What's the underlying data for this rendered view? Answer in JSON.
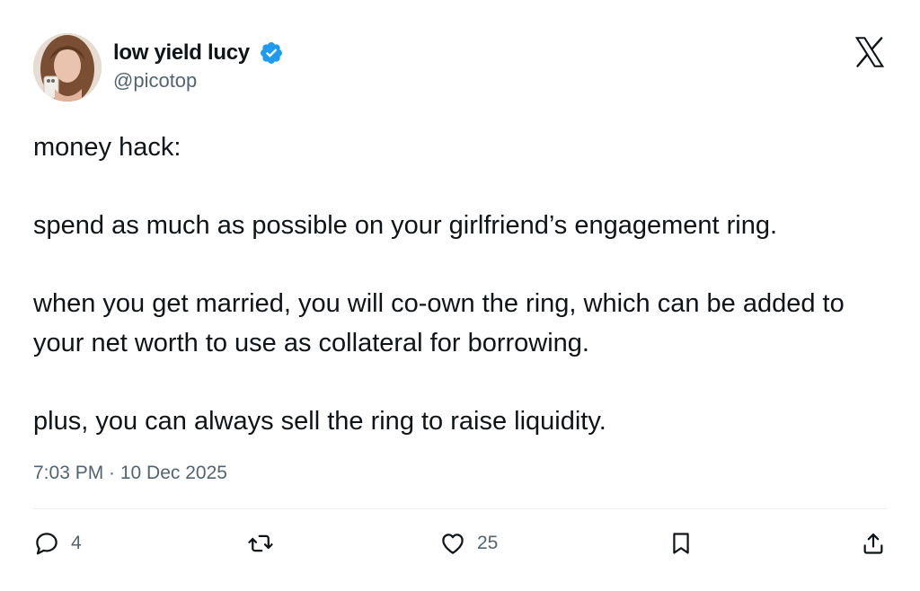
{
  "author": {
    "display_name": "low yield lucy",
    "handle": "@picotop",
    "verified": true
  },
  "tweet": {
    "paragraphs": [
      "money hack:",
      "spend as much as possible on your girlfriend’s engagement ring.",
      "when you get married, you will co-own the ring, which can be added to your net worth to use as collateral for borrowing.",
      "plus, you can always sell the ring to raise liquidity."
    ],
    "timestamp": "7:03 PM · 10 Dec 2025"
  },
  "actions": {
    "replies": "4",
    "retweets": "",
    "likes": "25"
  },
  "icons": {
    "close": "x-logo-icon",
    "verified": "verified-badge-icon",
    "reply": "reply-icon",
    "retweet": "retweet-icon",
    "like": "heart-icon",
    "bookmark": "bookmark-icon",
    "share": "share-icon"
  },
  "colors": {
    "text": "#0f1419",
    "secondary": "#536471",
    "verified": "#1d9bf0",
    "divider": "#eff3f4"
  }
}
